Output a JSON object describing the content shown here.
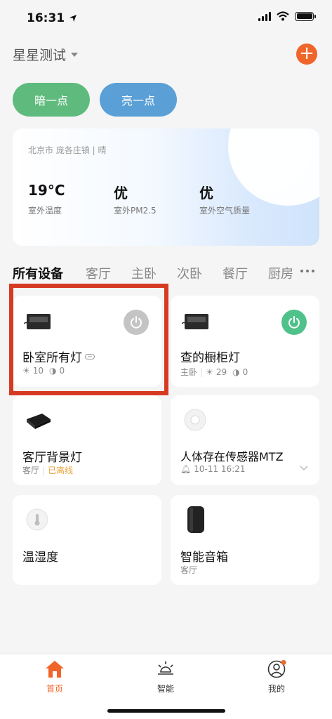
{
  "status": {
    "time": "16:31"
  },
  "header": {
    "home_name": "星星测试",
    "add": "+"
  },
  "scenes": [
    {
      "label": "暗一点",
      "color": "#5fbb7d"
    },
    {
      "label": "亮一点",
      "color": "#5aa0d6"
    }
  ],
  "weather": {
    "location": "北京市 庞各庄镇 | 晴",
    "items": [
      {
        "value": "19°C",
        "label": "室外温度"
      },
      {
        "value": "优",
        "label": "室外PM2.5"
      },
      {
        "value": "优",
        "label": "室外空气质量"
      }
    ]
  },
  "tabs": [
    "所有设备",
    "客厅",
    "主卧",
    "次卧",
    "餐厅",
    "厨房"
  ],
  "devices": [
    {
      "name": "卧室所有灯",
      "room": "",
      "brightness": "10",
      "color_temp": "0",
      "power": "off"
    },
    {
      "name": "查的橱柜灯",
      "room": "主卧",
      "brightness": "29",
      "color_temp": "0",
      "power": "on"
    },
    {
      "name": "客厅背景灯",
      "room": "客厅",
      "status": "已离线"
    },
    {
      "name": "人体存在传感器MTZ",
      "room": "",
      "time": "10-11 16:21"
    },
    {
      "name": "温湿度",
      "room": ""
    },
    {
      "name": "智能音箱",
      "room": "客厅"
    }
  ],
  "nav": [
    {
      "label": "首页",
      "icon": "home-icon",
      "active": true
    },
    {
      "label": "智能",
      "icon": "sun-icon",
      "active": false
    },
    {
      "label": "我的",
      "icon": "profile-icon",
      "active": false
    }
  ],
  "colors": {
    "accent": "#f0652a",
    "power_on": "#4fc18a",
    "power_off": "#c4c4c4",
    "highlight": "#d63a22",
    "offline": "#e8a33c"
  }
}
